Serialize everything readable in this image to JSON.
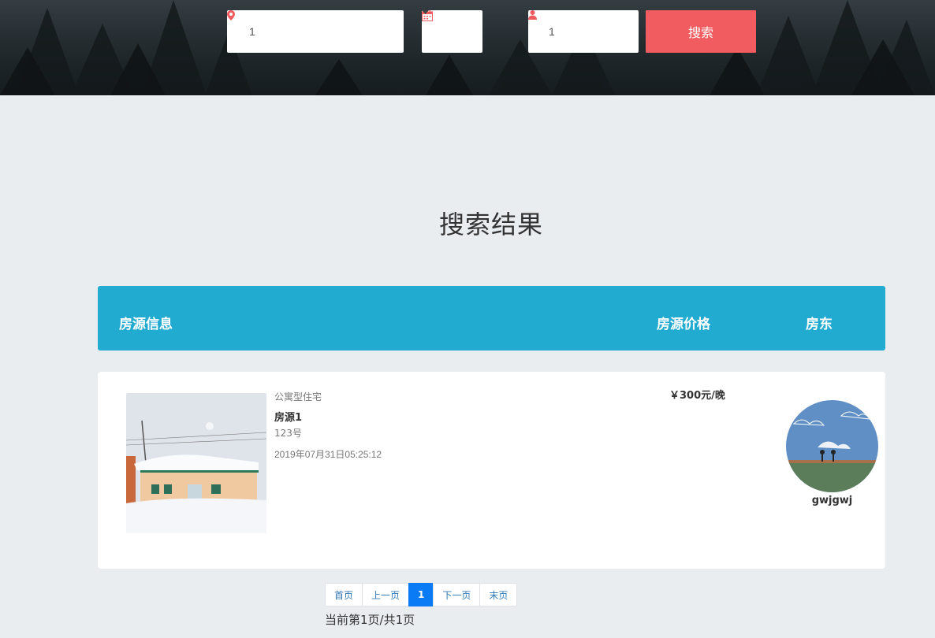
{
  "search": {
    "location_value": "1",
    "guests_value": "1",
    "button_label": "搜索"
  },
  "results": {
    "title": "搜索结果",
    "columns": {
      "info": "房源信息",
      "price": "房源价格",
      "host": "房东"
    },
    "listings": [
      {
        "type": "公寓型住宅",
        "name": "房源1",
        "address": "123号",
        "created": "2019年07月31日05:25:12",
        "price": "￥300元/晚",
        "host": "gwjgwj"
      }
    ]
  },
  "pagination": {
    "first": "首页",
    "prev": "上一页",
    "current": "1",
    "next": "下一页",
    "last": "末页",
    "info": "当前第1页/共1页"
  },
  "colors": {
    "accent": "#f05c5f",
    "header_bar": "#22abd1",
    "active_page": "#0a7bf5"
  }
}
